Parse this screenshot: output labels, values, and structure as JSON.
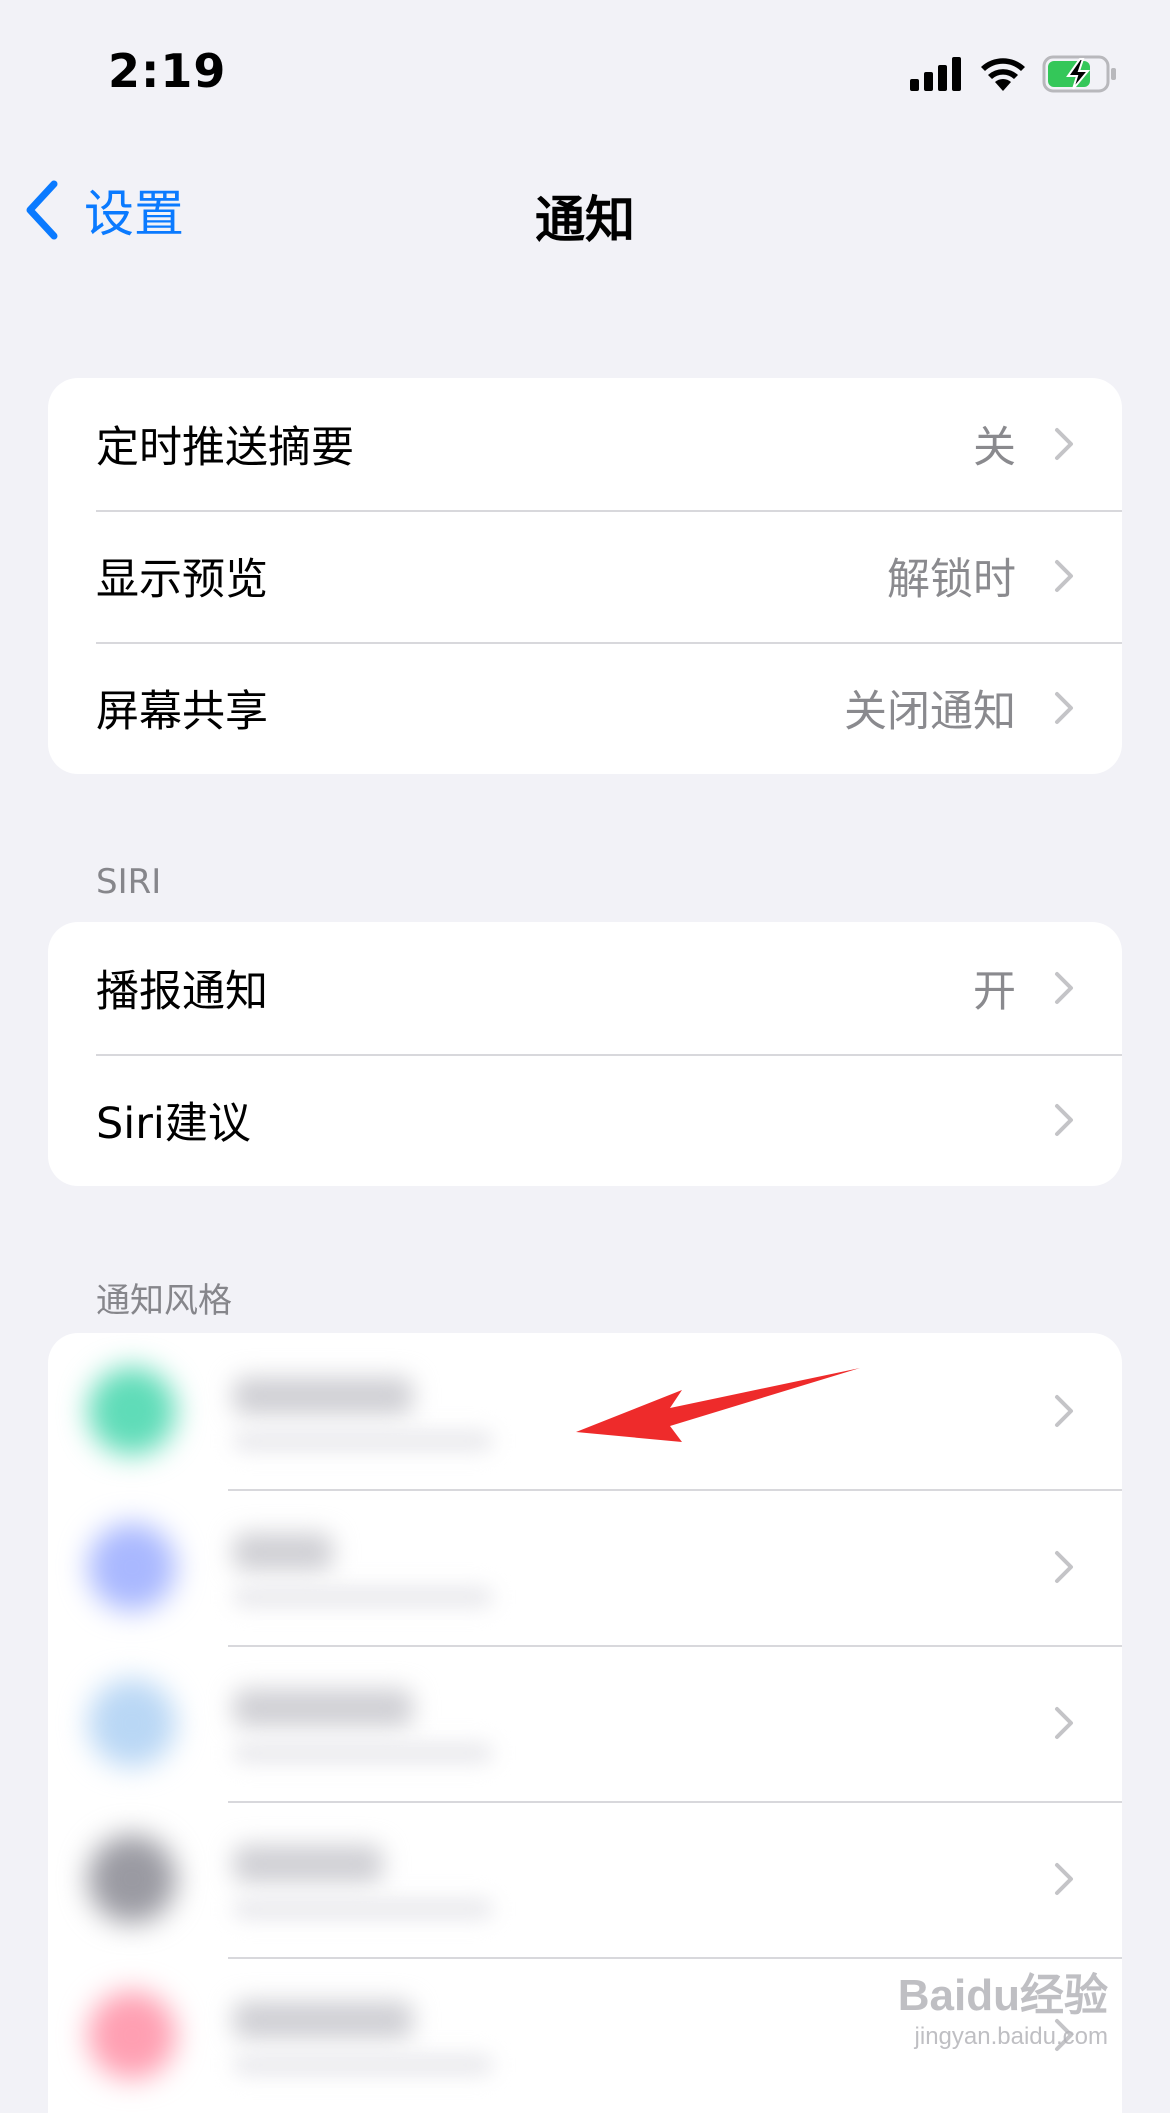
{
  "status_bar": {
    "time": "2:19",
    "icons": [
      "cellular-signal-icon",
      "wifi-icon",
      "battery-charging-icon"
    ]
  },
  "nav": {
    "back_label": "设置",
    "title": "通知"
  },
  "group1": {
    "rows": [
      {
        "label": "定时推送摘要",
        "value": "关"
      },
      {
        "label": "显示预览",
        "value": "解锁时"
      },
      {
        "label": "屏幕共享",
        "value": "关闭通知"
      }
    ]
  },
  "siri_section": {
    "header": "SIRI",
    "rows": [
      {
        "label": "播报通知",
        "value": "开"
      },
      {
        "label": "Siri建议",
        "value": ""
      }
    ]
  },
  "style_section": {
    "header": "通知风格",
    "apps": [
      {
        "icon_color": "#5fdcb8"
      },
      {
        "icon_color": "#a9b8ff"
      },
      {
        "icon_color": "#b9d7f5"
      },
      {
        "icon_color": "#9a9aa2"
      },
      {
        "icon_color": "#ff9fb2"
      }
    ]
  },
  "colors": {
    "accent": "#0a7aff",
    "annotation_arrow": "#ee2b2b"
  },
  "watermark": {
    "main": "Baidu经验",
    "sub": "jingyan.baidu.com"
  }
}
